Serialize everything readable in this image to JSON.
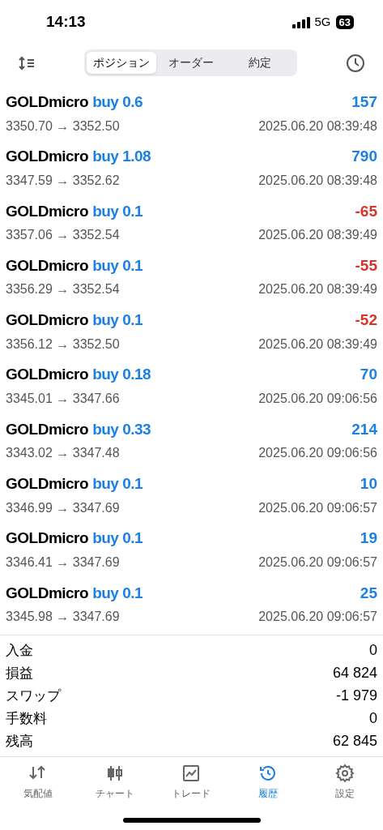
{
  "status_bar": {
    "time": "14:13",
    "network": "5G",
    "battery": "63"
  },
  "segments": [
    {
      "label": "ポジション",
      "selected": true
    },
    {
      "label": "オーダー",
      "selected": false
    },
    {
      "label": "約定",
      "selected": false
    }
  ],
  "deals": [
    {
      "symbol": "GOLDmicro",
      "side": "buy 0.6",
      "prices": "3350.70 → 3352.50",
      "profit": "157",
      "color": "#1a80e5",
      "time": "2025.06.20 08:39:48"
    },
    {
      "symbol": "GOLDmicro",
      "side": "buy 1.08",
      "prices": "3347.59 → 3352.62",
      "profit": "790",
      "color": "#1a80e5",
      "time": "2025.06.20 08:39:48"
    },
    {
      "symbol": "GOLDmicro",
      "side": "buy 0.1",
      "prices": "3357.06 → 3352.54",
      "profit": "-65",
      "color": "#d8352a",
      "time": "2025.06.20 08:39:49"
    },
    {
      "symbol": "GOLDmicro",
      "side": "buy 0.1",
      "prices": "3356.29 → 3352.54",
      "profit": "-55",
      "color": "#d8352a",
      "time": "2025.06.20 08:39:49"
    },
    {
      "symbol": "GOLDmicro",
      "side": "buy 0.1",
      "prices": "3356.12 → 3352.50",
      "profit": "-52",
      "color": "#d8352a",
      "time": "2025.06.20 08:39:49"
    },
    {
      "symbol": "GOLDmicro",
      "side": "buy 0.18",
      "prices": "3345.01 → 3347.66",
      "profit": "70",
      "color": "#1a80e5",
      "time": "2025.06.20 09:06:56"
    },
    {
      "symbol": "GOLDmicro",
      "side": "buy 0.33",
      "prices": "3343.02 → 3347.48",
      "profit": "214",
      "color": "#1a80e5",
      "time": "2025.06.20 09:06:56"
    },
    {
      "symbol": "GOLDmicro",
      "side": "buy 0.1",
      "prices": "3346.99 → 3347.69",
      "profit": "10",
      "color": "#1a80e5",
      "time": "2025.06.20 09:06:57"
    },
    {
      "symbol": "GOLDmicro",
      "side": "buy 0.1",
      "prices": "3346.41 → 3347.69",
      "profit": "19",
      "color": "#1a80e5",
      "time": "2025.06.20 09:06:57"
    },
    {
      "symbol": "GOLDmicro",
      "side": "buy 0.1",
      "prices": "3345.98 → 3347.69",
      "profit": "25",
      "color": "#1a80e5",
      "time": "2025.06.20 09:06:57"
    }
  ],
  "summary": [
    {
      "label": "入金",
      "value": "0"
    },
    {
      "label": "損益",
      "value": "64 824"
    },
    {
      "label": "スワップ",
      "value": "-1 979"
    },
    {
      "label": "手数料",
      "value": "0"
    },
    {
      "label": "残高",
      "value": "62 845"
    }
  ],
  "tab_bar": [
    {
      "kind": "quotes",
      "label": "気配値",
      "selected": false
    },
    {
      "kind": "chart",
      "label": "チャート",
      "selected": false
    },
    {
      "kind": "trade",
      "label": "トレード",
      "selected": false
    },
    {
      "kind": "history",
      "label": "履歴",
      "selected": true
    },
    {
      "kind": "settings",
      "label": "設定",
      "selected": false
    }
  ]
}
